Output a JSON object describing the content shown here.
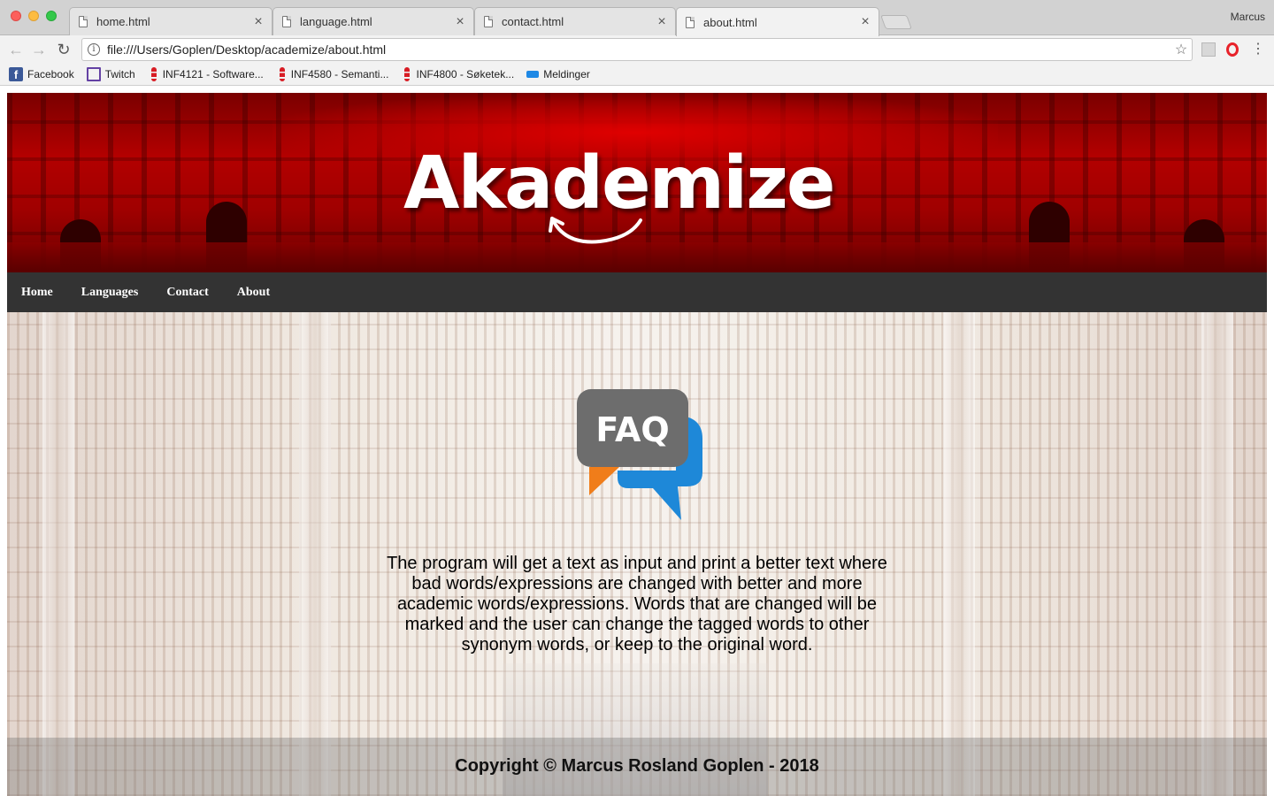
{
  "browser": {
    "tabs": [
      {
        "title": "home.html",
        "active": false
      },
      {
        "title": "language.html",
        "active": false
      },
      {
        "title": "contact.html",
        "active": false
      },
      {
        "title": "about.html",
        "active": true
      }
    ],
    "profile_name": "Marcus",
    "url": "file:///Users/Goplen/Desktop/academize/about.html",
    "bookmarks": [
      {
        "label": "Facebook",
        "icon": "facebook-icon"
      },
      {
        "label": "Twitch",
        "icon": "twitch-icon"
      },
      {
        "label": "INF4121 - Software...",
        "icon": "uio-icon"
      },
      {
        "label": "INF4580 - Semanti...",
        "icon": "uio-icon"
      },
      {
        "label": "INF4800 - Søketek...",
        "icon": "uio-icon"
      },
      {
        "label": "Meldinger",
        "icon": "messages-icon"
      }
    ],
    "colors": {
      "tab_bar": "#d2d2d2",
      "toolbar": "#f2f2f2"
    }
  },
  "site": {
    "logo_text": "Akademize",
    "nav": [
      "Home",
      "Languages",
      "Contact",
      "About"
    ],
    "faq_label": "FAQ",
    "description": "The program will get a text as input and print a better text where bad words/expressions are changed with better and more academic words/expressions. Words that are changed will be marked and the user can change the tagged words to other synonym words, or keep to the original word.",
    "footer": "Copyright © Marcus Rosland Goplen - 2018",
    "colors": {
      "header_red": "#b30000",
      "navbar": "#333333",
      "faq_bubble": "#6d6d6d",
      "faq_orange": "#f07d1a",
      "faq_blue": "#1e88d8"
    }
  }
}
